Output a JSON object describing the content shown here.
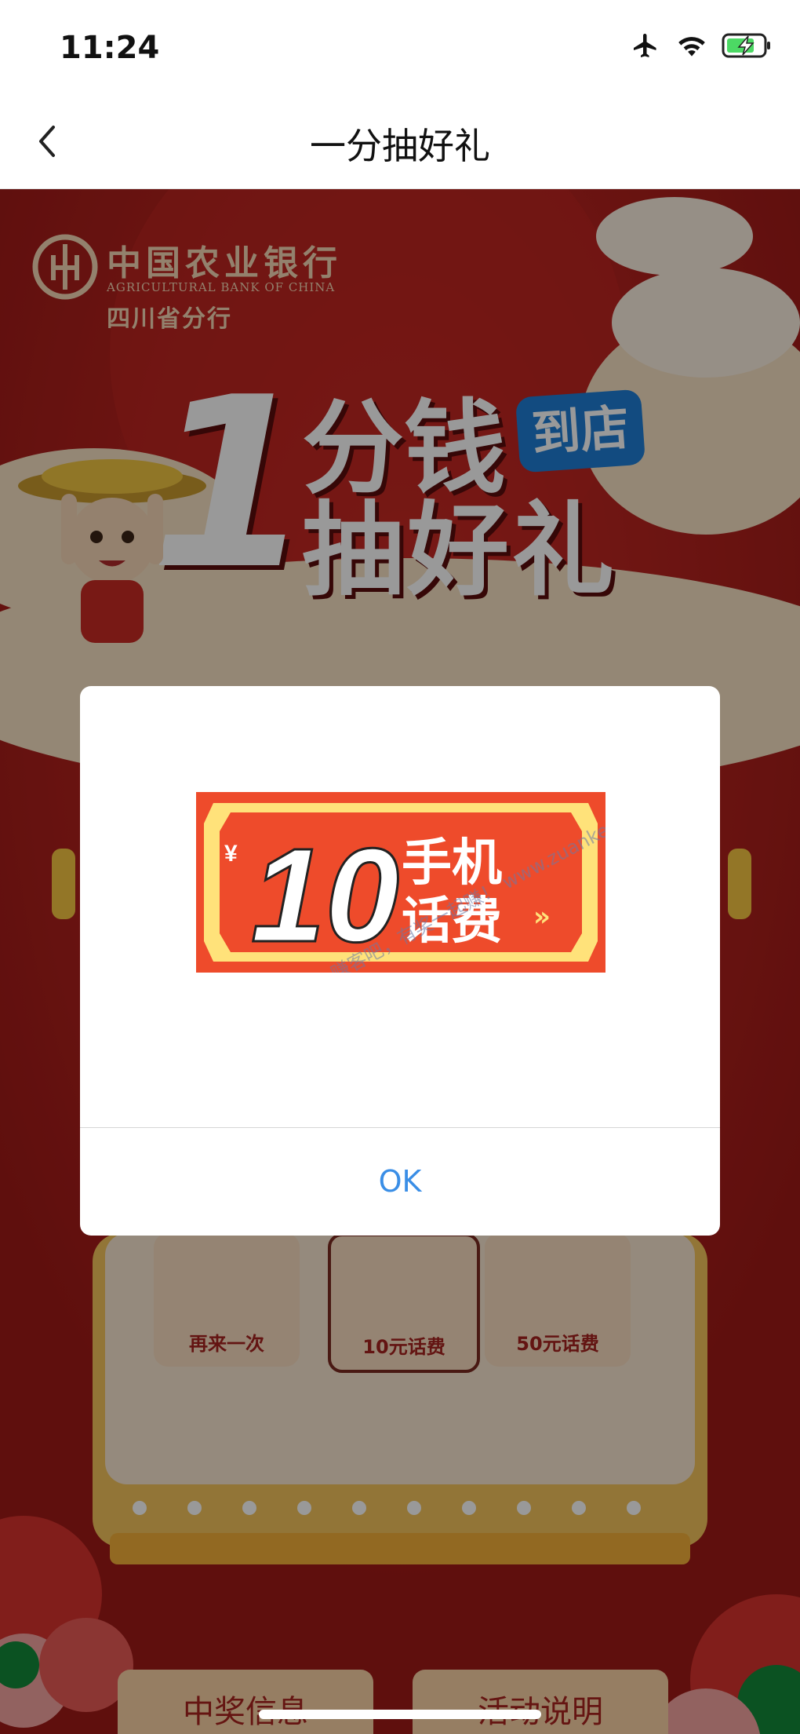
{
  "status_bar": {
    "time": "11:24"
  },
  "nav": {
    "title": "一分抽好礼"
  },
  "banner": {
    "bank_name_cn": "中国农业银行",
    "bank_name_en": "AGRICULTURAL BANK OF CHINA",
    "branch": "四川省分行",
    "hero_digit": "1",
    "hero_line1": "分钱",
    "hero_badge": "到店",
    "hero_line2": "抽好礼"
  },
  "slot_machine": {
    "prizes": [
      {
        "label": "再来一次"
      },
      {
        "label": "10元话费"
      },
      {
        "label": "50元话费"
      }
    ]
  },
  "buttons": {
    "winner_info": "中奖信息",
    "activity_rules": "活动说明"
  },
  "dialog": {
    "coupon": {
      "currency": "¥",
      "amount": "10",
      "line1": "手机",
      "line2": "话费",
      "arrows": "»",
      "watermark": "赚客吧，有奖一起赚！ www.zuanke8.com"
    },
    "ok_label": "OK"
  },
  "colors": {
    "page_red": "#b3201d",
    "coupon_orange": "#ee4b2b",
    "coupon_yellow": "#ffe27a",
    "ok_blue": "#3a8ee6"
  }
}
